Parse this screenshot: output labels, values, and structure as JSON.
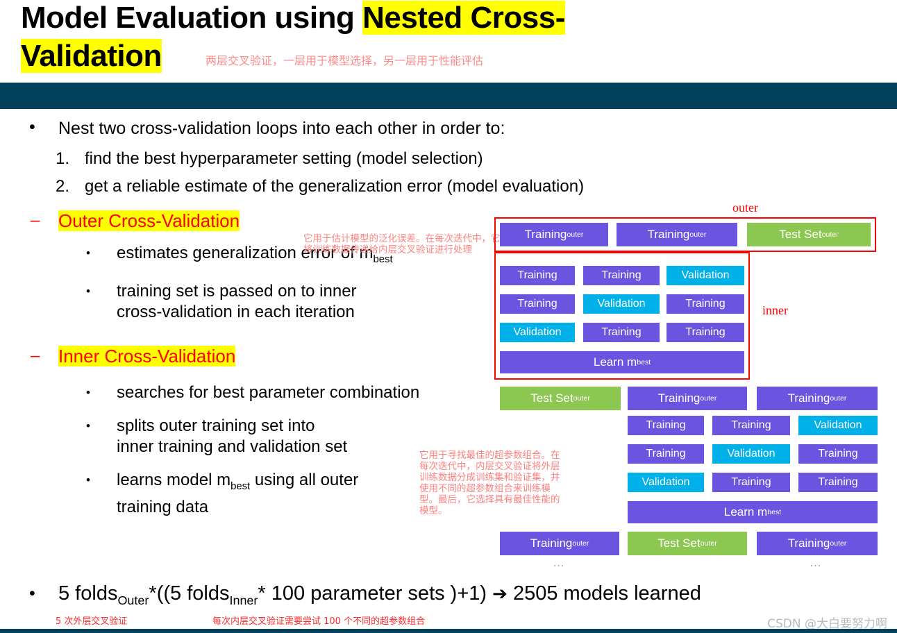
{
  "title": {
    "line1_plain": "Model Evaluation using ",
    "line1_highlight": "Nested Cross-",
    "line2_highlight": "Validation",
    "annotation_cn": "两层交叉验证，一层用于模型选择，另一层用于性能评估"
  },
  "body": {
    "lead_bullet": "Nest two cross-validation loops into each other in order to:",
    "numbered": [
      {
        "num": "1.",
        "text": "find the best hyperparameter setting (model selection)"
      },
      {
        "num": "2.",
        "text": "get a reliable estimate of the generalization error (model evaluation)"
      }
    ],
    "outer_heading": "Outer Cross-Validation",
    "outer_note_cn": "它用于估计模型的泛化误差。在每次迭代中，它将训练数据传递给内层交叉验证进行处理",
    "outer_points": [
      {
        "pre": "estimates generalization error of m",
        "sub": "best",
        "post": ""
      },
      {
        "pre": "training set is passed on to inner",
        "sub": "",
        "post": ""
      },
      {
        "pre": "cross-validation in each iteration",
        "sub": "",
        "post": ""
      }
    ],
    "inner_heading": "Inner Cross-Validation",
    "inner_note_cn": "它用于寻找最佳的超参数组合。在每次迭代中，内层交叉验证将外层训练数据分成训练集和验证集，并使用不同的超参数组合来训练模型。最后，它选择具有最佳性能的模型。",
    "inner_points": [
      {
        "pre": "searches for best parameter combination",
        "sub": "",
        "post": ""
      },
      {
        "pre": "splits outer training set into",
        "sub": "",
        "post": ""
      },
      {
        "pre": "inner training and validation set",
        "sub": "",
        "post": ""
      },
      {
        "pre": "learns model m",
        "sub": "best",
        "post": " using all outer"
      },
      {
        "pre": "training data",
        "sub": "",
        "post": ""
      }
    ]
  },
  "summary": {
    "p1": "5 folds",
    "sub1": "Outer",
    "p2": "*((5 folds",
    "sub2": "Inner",
    "p3": "* 100 parameter sets )+1) ",
    "arrow": "➔",
    "p4": " 2505 models learned",
    "cn_left": "5 次外层交叉验证",
    "cn_right": "每次内层交叉验证需要尝试 100 个不同的超参数组合",
    "watermark": "CSDN @大白要努力啊"
  },
  "diagram": {
    "labels": {
      "outer": "outer",
      "inner": "inner",
      "ellipsis": "…"
    },
    "colors": {
      "purple": "#6b55e0",
      "green": "#8cc751",
      "cyan": "#00b0e8",
      "outline": "#ff0000",
      "darkbar": "#04415c",
      "highlight": "#ffff00",
      "heading_red": "#ff0000"
    },
    "iteration1": {
      "outer_row": [
        {
          "label": "Training",
          "sub": "outer",
          "color": "purple"
        },
        {
          "label": "Training",
          "sub": "outer",
          "color": "purple"
        },
        {
          "label": "Test Set",
          "sub": "outer",
          "color": "green"
        }
      ],
      "inner_rows": [
        [
          {
            "label": "Training",
            "color": "purple"
          },
          {
            "label": "Training",
            "color": "purple"
          },
          {
            "label": "Validation",
            "color": "cyan"
          }
        ],
        [
          {
            "label": "Training",
            "color": "purple"
          },
          {
            "label": "Validation",
            "color": "cyan"
          },
          {
            "label": "Training",
            "color": "purple"
          }
        ],
        [
          {
            "label": "Validation",
            "color": "cyan"
          },
          {
            "label": "Training",
            "color": "purple"
          },
          {
            "label": "Training",
            "color": "purple"
          }
        ]
      ],
      "learn": {
        "label": "Learn m",
        "sub": "best",
        "color": "purple"
      }
    },
    "iteration2": {
      "outer_row": [
        {
          "label": "Test Set",
          "sub": "outer",
          "color": "green"
        },
        {
          "label": "Training",
          "sub": "outer",
          "color": "purple"
        },
        {
          "label": "Training",
          "sub": "outer",
          "color": "purple"
        }
      ],
      "inner_rows": [
        [
          {
            "label": "Training",
            "color": "purple"
          },
          {
            "label": "Training",
            "color": "purple"
          },
          {
            "label": "Validation",
            "color": "cyan"
          }
        ],
        [
          {
            "label": "Training",
            "color": "purple"
          },
          {
            "label": "Validation",
            "color": "cyan"
          },
          {
            "label": "Training",
            "color": "purple"
          }
        ],
        [
          {
            "label": "Validation",
            "color": "cyan"
          },
          {
            "label": "Training",
            "color": "purple"
          },
          {
            "label": "Training",
            "color": "purple"
          }
        ]
      ],
      "learn": {
        "label": "Learn m",
        "sub": "best",
        "color": "purple"
      }
    },
    "iteration3": {
      "outer_row": [
        {
          "label": "Training",
          "sub": "outer",
          "color": "purple"
        },
        {
          "label": "Test Set",
          "sub": "outer",
          "color": "green"
        },
        {
          "label": "Training",
          "sub": "outer",
          "color": "purple"
        }
      ]
    }
  }
}
